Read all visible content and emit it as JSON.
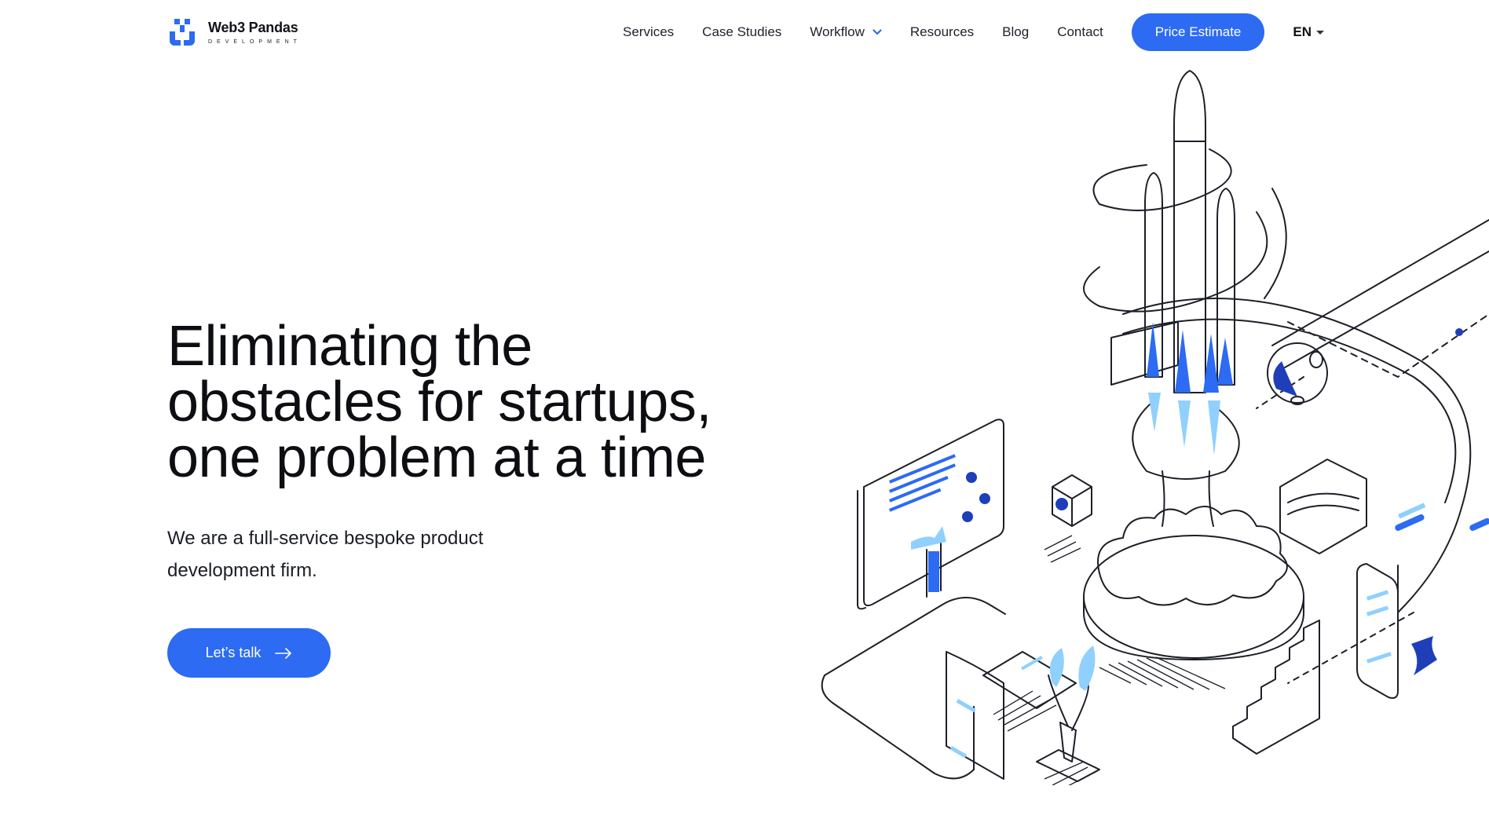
{
  "brand": {
    "name": "Web3 Pandas",
    "tagline": "DEVELOPMENT",
    "accent_color": "#2c6bf2"
  },
  "nav": {
    "items": [
      {
        "label": "Services"
      },
      {
        "label": "Case Studies"
      },
      {
        "label": "Workflow",
        "icon": "chevron-down-icon"
      },
      {
        "label": "Resources"
      },
      {
        "label": "Blog"
      },
      {
        "label": "Contact"
      }
    ],
    "cta_label": "Price Estimate",
    "language": "EN"
  },
  "hero": {
    "title_lines": [
      "Eliminating the",
      "obstacles for startups,",
      "one problem at a time"
    ],
    "subtitle_lines": [
      "We are a full-service bespoke product",
      "development firm."
    ],
    "cta_label": "Let’s talk",
    "cta_icon": "arrow-right-icon"
  },
  "illustration": {
    "subject": "rocket-launch-isometric-illustration",
    "colors": {
      "line": "#1c1f26",
      "primary": "#2c6bf2",
      "dark": "#1e3fb8",
      "light": "#8fd0ff"
    }
  }
}
